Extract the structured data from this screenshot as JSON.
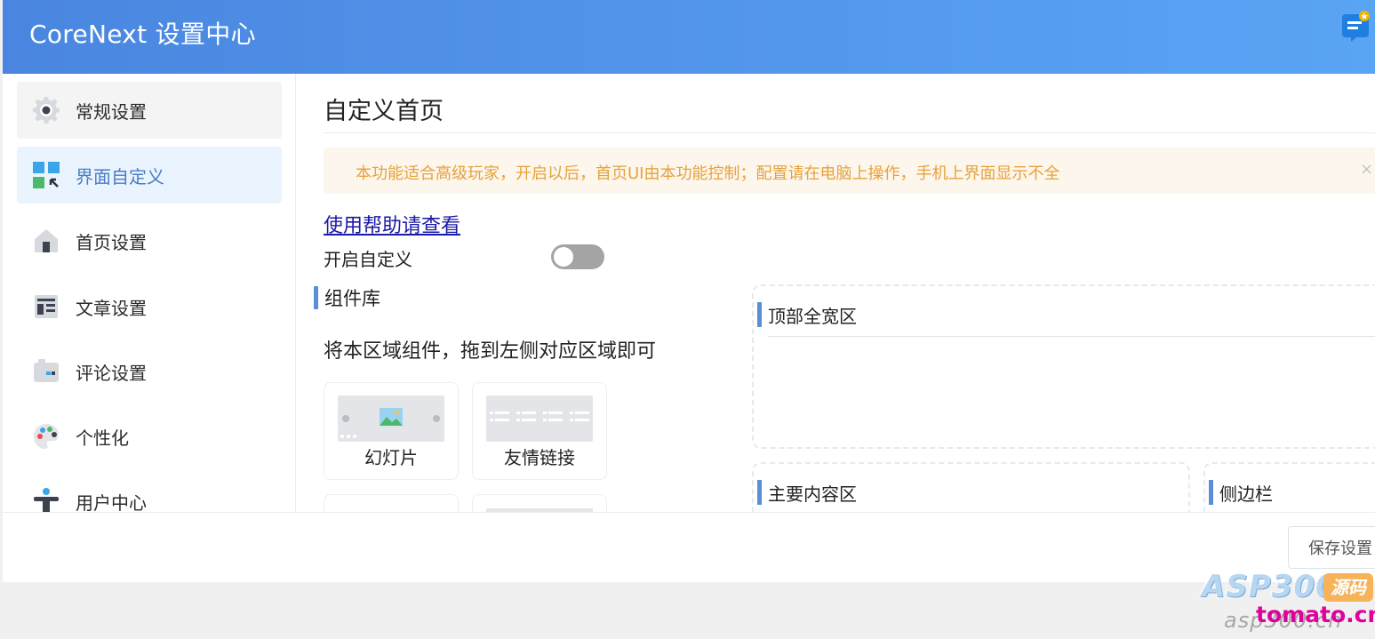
{
  "header": {
    "title": "CoreNext 设置中心"
  },
  "sidebar": {
    "items": [
      {
        "label": "常规设置"
      },
      {
        "label": "界面自定义"
      },
      {
        "label": "首页设置"
      },
      {
        "label": "文章设置"
      },
      {
        "label": "评论设置"
      },
      {
        "label": "个性化"
      },
      {
        "label": "用户中心"
      }
    ]
  },
  "main": {
    "title": "自定义首页",
    "alert": {
      "text": "本功能适合高级玩家，开启以后，首页UI由本功能控制；配置请在电脑上操作，手机上界面显示不全",
      "close": "×"
    },
    "help_link": "使用帮助请查看",
    "toggle": {
      "label": "开启自定义",
      "on": false
    },
    "library": {
      "title": "组件库",
      "description": "将本区域组件，拖到左侧对应区域即可",
      "components": [
        {
          "label": "幻灯片"
        },
        {
          "label": "友情链接"
        }
      ]
    },
    "zones": {
      "top": "顶部全宽区",
      "main": "主要内容区",
      "side": "侧边栏"
    }
  },
  "footer": {
    "save_label": "保存设置"
  },
  "watermark": {
    "brand": "ASP300",
    "badge": "源码",
    "sub": "asp300.cn",
    "overlay": "tomato.cm"
  },
  "colors": {
    "header_from": "#4a86e0",
    "header_to": "#5aa4f4",
    "accent": "#5a8ed6",
    "alert_bg": "#fdf6ec",
    "alert_text": "#e6a23c",
    "active_bg": "#eaf4fe"
  }
}
